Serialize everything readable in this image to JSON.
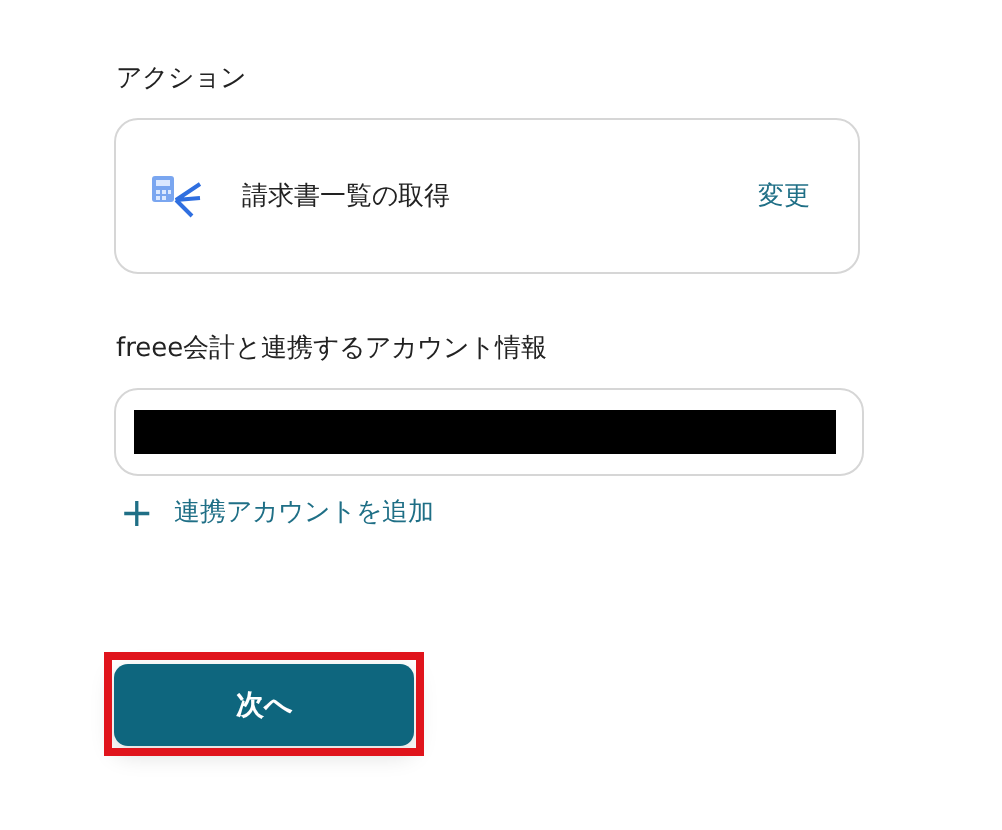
{
  "action_section": {
    "label": "アクション",
    "action": {
      "title": "請求書一覧の取得",
      "change_link": "変更"
    }
  },
  "account_section": {
    "label": "freee会計と連携するアカウント情報",
    "account_field": {
      "redacted": true
    },
    "add_link": {
      "icon": "+",
      "label": "連携アカウントを追加"
    }
  },
  "next_button": {
    "label": "次へ",
    "highlighted": true
  }
}
